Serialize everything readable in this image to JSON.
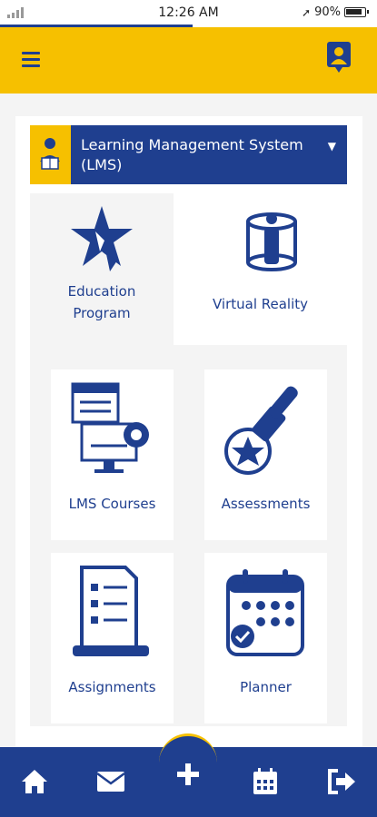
{
  "status_bar": {
    "time": "12:26 AM",
    "battery": "90%"
  },
  "header": {
    "menu_icon": "hamburger-menu-icon",
    "profile_icon": "user-badge-icon"
  },
  "selector": {
    "label": "Learning Management System (LMS)",
    "icon": "student-avatar-icon",
    "chevron_icon": "chevron-down-icon"
  },
  "tiles": [
    {
      "label": "Education Program",
      "icon": "star-education-icon"
    },
    {
      "label": "Virtual Reality",
      "icon": "vr-person-icon"
    },
    {
      "label": "LMS Courses",
      "icon": "computer-gear-icon"
    },
    {
      "label": "Assessments",
      "icon": "stamp-star-icon"
    },
    {
      "label": "Assignments",
      "icon": "document-laptop-icon"
    },
    {
      "label": "Planner",
      "icon": "calendar-check-icon"
    }
  ],
  "bottom_nav": {
    "items": [
      "home-icon",
      "mail-icon",
      "plus-icon",
      "calendar-icon",
      "logout-icon"
    ]
  },
  "colors": {
    "primary": "#1f3f8f",
    "accent": "#f6c000",
    "background": "#f4f4f4"
  }
}
